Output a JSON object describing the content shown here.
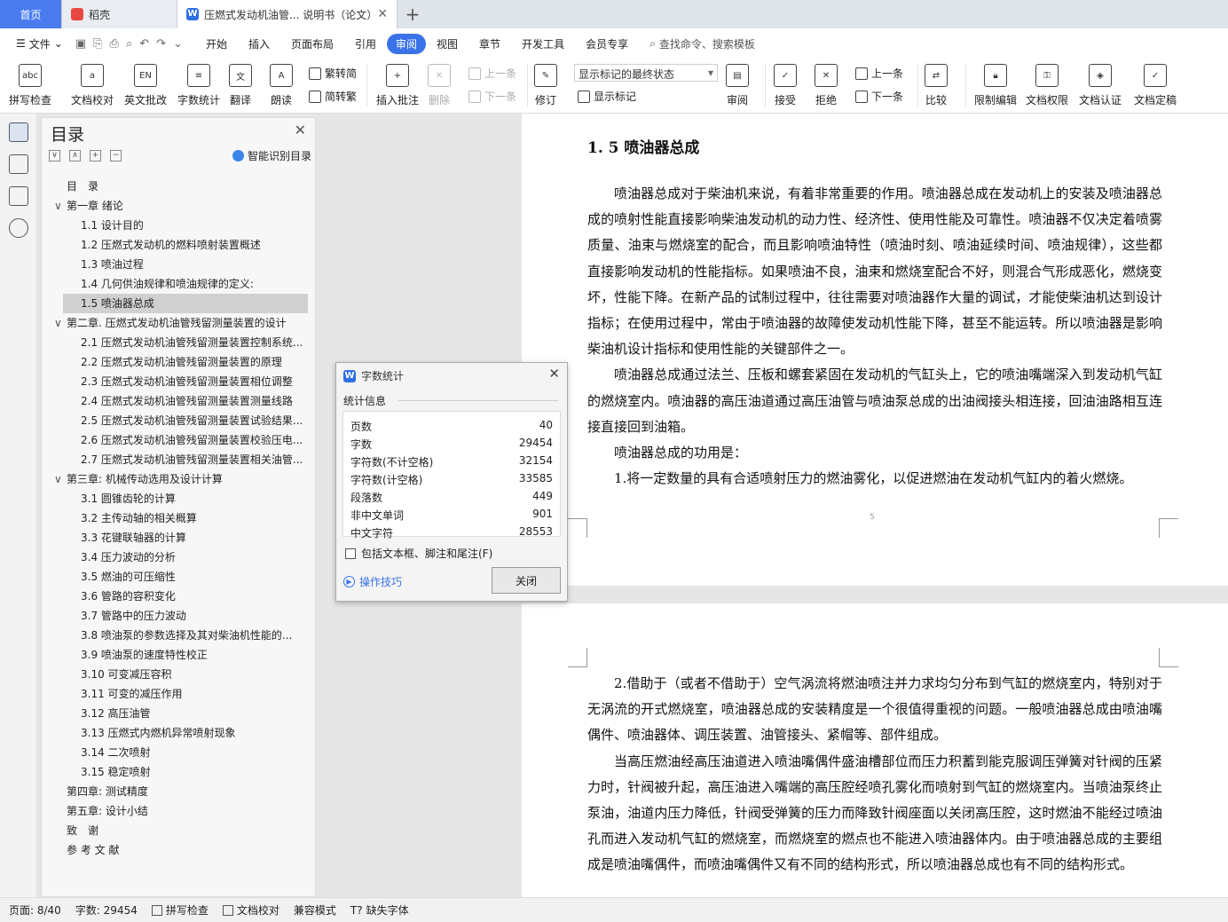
{
  "tabs": {
    "home": "首页",
    "shell": "稻壳",
    "doc": "压燃式发动机油管... 说明书（论文）"
  },
  "menu": {
    "file": "文件",
    "items": [
      "开始",
      "插入",
      "页面布局",
      "引用",
      "审阅",
      "视图",
      "章节",
      "开发工具",
      "会员专享"
    ],
    "active": "审阅",
    "search": "查找命令、搜索模板"
  },
  "ribbon": {
    "spellcheck": "拼写检查",
    "doc_proof": "文档校对",
    "en_review": "英文批改",
    "word_count": "字数统计",
    "translate": "翻译",
    "read_aloud": "朗读",
    "trad_simp": "繁转简",
    "simp_trad": "简转繁",
    "insert_comment": "插入批注",
    "delete": "删除",
    "prev": "上一条",
    "next": "下一条",
    "revise": "修订",
    "markup_state": "显示标记的最终状态",
    "show_markup": "显示标记",
    "review": "审阅",
    "accept": "接受",
    "reject": "拒绝",
    "prev2": "上一条",
    "next2": "下一条",
    "compare": "比较",
    "restrict": "限制编辑",
    "doc_perm": "文档权限",
    "doc_cert": "文档认证",
    "doc_final": "文档定稿"
  },
  "toc": {
    "title": "目录",
    "smart": "智能识别目录",
    "items": [
      {
        "text": "目　录",
        "level": 0
      },
      {
        "text": "第一章 绪论",
        "level": 1,
        "caret": "∨"
      },
      {
        "text": "1.1 设计目的",
        "level": 2
      },
      {
        "text": "1.2 压燃式发动机的燃料喷射装置概述",
        "level": 2
      },
      {
        "text": "1.3 喷油过程",
        "level": 2
      },
      {
        "text": "1.4 几何供油规律和喷油规律的定义:",
        "level": 2
      },
      {
        "text": "1.5 喷油器总成",
        "level": 2,
        "selected": true
      },
      {
        "text": "第二章. 压燃式发动机油管残留测量装置的设计",
        "level": 1,
        "caret": "∨"
      },
      {
        "text": "2.1 压燃式发动机油管残留测量装置控制系统...",
        "level": 2
      },
      {
        "text": "2.2 压燃式发动机油管残留测量装置的原理",
        "level": 2
      },
      {
        "text": "2.3 压燃式发动机油管残留测量装置相位调整",
        "level": 2
      },
      {
        "text": "2.4 压燃式发动机油管残留测量装置测量线路",
        "level": 2
      },
      {
        "text": "2.5 压燃式发动机油管残留测量装置试验结果...",
        "level": 2
      },
      {
        "text": "2.6 压燃式发动机油管残留测量装置校验压电...",
        "level": 2
      },
      {
        "text": "2.7 压燃式发动机油管残留测量装置相关油管...",
        "level": 2
      },
      {
        "text": "第三章: 机械传动选用及设计计算",
        "level": 1,
        "caret": "∨"
      },
      {
        "text": "3.1 圆锥齿轮的计算",
        "level": 2
      },
      {
        "text": "3.2 主传动轴的相关概算",
        "level": 2
      },
      {
        "text": "3.3 花键联轴器的计算",
        "level": 2
      },
      {
        "text": "3.4 压力波动的分析",
        "level": 2
      },
      {
        "text": "3.5 燃油的可压缩性",
        "level": 2
      },
      {
        "text": "3.6 管路的容积变化",
        "level": 2
      },
      {
        "text": "3.7 管路中的压力波动",
        "level": 2
      },
      {
        "text": "3.8 喷油泵的参数选择及其对柴油机性能的...",
        "level": 2
      },
      {
        "text": "3.9 喷油泵的速度特性校正",
        "level": 2
      },
      {
        "text": "3.10 可变减压容积",
        "level": 2
      },
      {
        "text": "3.11 可变的减压作用",
        "level": 2
      },
      {
        "text": "3.12 高压油管",
        "level": 2
      },
      {
        "text": "3.13 压燃式内燃机异常喷射现象",
        "level": 2
      },
      {
        "text": "3.14 二次喷射",
        "level": 2
      },
      {
        "text": "3.15 稳定喷射",
        "level": 2
      },
      {
        "text": "第四章: 测试精度",
        "level": 0
      },
      {
        "text": "第五章: 设计小结",
        "level": 0
      },
      {
        "text": "致　谢",
        "level": 0
      },
      {
        "text": "参 考 文 献",
        "level": 0
      }
    ]
  },
  "document": {
    "heading": "1. 5 喷油器总成",
    "page1_paras": [
      "喷油器总成对于柴油机来说，有着非常重要的作用。喷油器总成在发动机上的安装及喷油器总成的喷射性能直接影响柴油发动机的动力性、经济性、使用性能及可靠性。喷油器不仅决定着喷雾质量、油束与燃烧室的配合，而且影响喷油特性（喷油时刻、喷油延续时间、喷油规律），这些都直接影响发动机的性能指标。如果喷油不良，油束和燃烧室配合不好，则混合气形成恶化，燃烧变坏，性能下降。在新产品的试制过程中，往往需要对喷油器作大量的调试，才能使柴油机达到设计指标；在使用过程中，常由于喷油器的故障使发动机性能下降，甚至不能运转。所以喷油器是影响柴油机设计指标和使用性能的关键部件之一。",
      "喷油器总成通过法兰、压板和螺套紧固在发动机的气缸头上，它的喷油嘴端深入到发动机气缸的燃烧室内。喷油器的高压油道通过高压油管与喷油泵总成的出油阀接头相连接，回油油路相互连接直接回到油箱。",
      "喷油器总成的功用是：",
      "1.将一定数量的具有合适喷射压力的燃油雾化，以促进燃油在发动机气缸内的着火燃烧。"
    ],
    "page_number": "5",
    "page2_paras": [
      "2.借助于（或者不借助于）空气涡流将燃油喷注并力求均匀分布到气缸的燃烧室内，特别对于无涡流的开式燃烧室，喷油器总成的安装精度是一个很值得重视的问题。一般喷油器总成由喷油嘴偶件、喷油器体、调压装置、油管接头、紧帽等、部件组成。",
      "当高压燃油经高压油道进入喷油嘴偶件盛油槽部位而压力积蓄到能克服调压弹簧对针阀的压紧力时，针阀被升起，高压油进入嘴端的高压腔经喷孔雾化而喷射到气缸的燃烧室内。当喷油泵终止泵油，油道内压力降低，针阀受弹簧的压力而降致针阀座面以关闭高压腔，这时燃油不能经过喷油孔而进入发动机气缸的燃烧室，而燃烧室的燃点也不能进入喷油器体内。由于喷油器总成的主要组成是喷油嘴偶件，而喷油嘴偶件又有不同的结构形式，所以喷油器总成也有不同的结构形式。"
    ]
  },
  "dialog": {
    "title": "字数统计",
    "section": "统计信息",
    "stats": [
      {
        "label": "页数",
        "value": "40"
      },
      {
        "label": "字数",
        "value": "29454"
      },
      {
        "label": "字符数(不计空格)",
        "value": "32154"
      },
      {
        "label": "字符数(计空格)",
        "value": "33585"
      },
      {
        "label": "段落数",
        "value": "449"
      },
      {
        "label": "非中文单词",
        "value": "901"
      },
      {
        "label": "中文字符",
        "value": "28553"
      }
    ],
    "checkbox": "包括文本框、脚注和尾注(F)",
    "tips": "操作技巧",
    "close": "关闭"
  },
  "status": {
    "page": "页面: 8/40",
    "words": "字数: 29454",
    "spell": "拼写检查",
    "proof": "文档校对",
    "compat": "兼容模式",
    "missing_font": "缺失字体"
  }
}
